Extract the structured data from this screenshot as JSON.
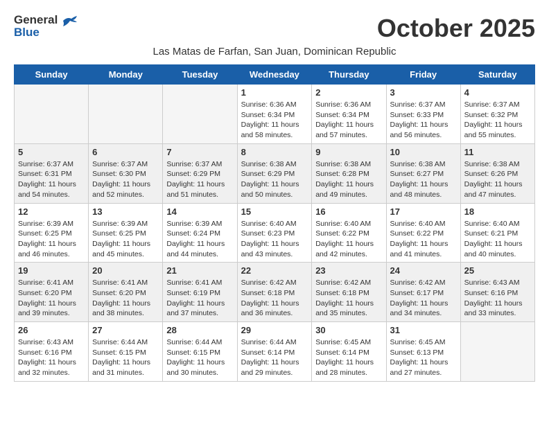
{
  "logo": {
    "general": "General",
    "blue": "Blue"
  },
  "title": "October 2025",
  "subtitle": "Las Matas de Farfan, San Juan, Dominican Republic",
  "days_of_week": [
    "Sunday",
    "Monday",
    "Tuesday",
    "Wednesday",
    "Thursday",
    "Friday",
    "Saturday"
  ],
  "weeks": [
    [
      {
        "day": "",
        "info": ""
      },
      {
        "day": "",
        "info": ""
      },
      {
        "day": "",
        "info": ""
      },
      {
        "day": "1",
        "info": "Sunrise: 6:36 AM\nSunset: 6:34 PM\nDaylight: 11 hours\nand 58 minutes."
      },
      {
        "day": "2",
        "info": "Sunrise: 6:36 AM\nSunset: 6:34 PM\nDaylight: 11 hours\nand 57 minutes."
      },
      {
        "day": "3",
        "info": "Sunrise: 6:37 AM\nSunset: 6:33 PM\nDaylight: 11 hours\nand 56 minutes."
      },
      {
        "day": "4",
        "info": "Sunrise: 6:37 AM\nSunset: 6:32 PM\nDaylight: 11 hours\nand 55 minutes."
      }
    ],
    [
      {
        "day": "5",
        "info": "Sunrise: 6:37 AM\nSunset: 6:31 PM\nDaylight: 11 hours\nand 54 minutes."
      },
      {
        "day": "6",
        "info": "Sunrise: 6:37 AM\nSunset: 6:30 PM\nDaylight: 11 hours\nand 52 minutes."
      },
      {
        "day": "7",
        "info": "Sunrise: 6:37 AM\nSunset: 6:29 PM\nDaylight: 11 hours\nand 51 minutes."
      },
      {
        "day": "8",
        "info": "Sunrise: 6:38 AM\nSunset: 6:29 PM\nDaylight: 11 hours\nand 50 minutes."
      },
      {
        "day": "9",
        "info": "Sunrise: 6:38 AM\nSunset: 6:28 PM\nDaylight: 11 hours\nand 49 minutes."
      },
      {
        "day": "10",
        "info": "Sunrise: 6:38 AM\nSunset: 6:27 PM\nDaylight: 11 hours\nand 48 minutes."
      },
      {
        "day": "11",
        "info": "Sunrise: 6:38 AM\nSunset: 6:26 PM\nDaylight: 11 hours\nand 47 minutes."
      }
    ],
    [
      {
        "day": "12",
        "info": "Sunrise: 6:39 AM\nSunset: 6:25 PM\nDaylight: 11 hours\nand 46 minutes."
      },
      {
        "day": "13",
        "info": "Sunrise: 6:39 AM\nSunset: 6:25 PM\nDaylight: 11 hours\nand 45 minutes."
      },
      {
        "day": "14",
        "info": "Sunrise: 6:39 AM\nSunset: 6:24 PM\nDaylight: 11 hours\nand 44 minutes."
      },
      {
        "day": "15",
        "info": "Sunrise: 6:40 AM\nSunset: 6:23 PM\nDaylight: 11 hours\nand 43 minutes."
      },
      {
        "day": "16",
        "info": "Sunrise: 6:40 AM\nSunset: 6:22 PM\nDaylight: 11 hours\nand 42 minutes."
      },
      {
        "day": "17",
        "info": "Sunrise: 6:40 AM\nSunset: 6:22 PM\nDaylight: 11 hours\nand 41 minutes."
      },
      {
        "day": "18",
        "info": "Sunrise: 6:40 AM\nSunset: 6:21 PM\nDaylight: 11 hours\nand 40 minutes."
      }
    ],
    [
      {
        "day": "19",
        "info": "Sunrise: 6:41 AM\nSunset: 6:20 PM\nDaylight: 11 hours\nand 39 minutes."
      },
      {
        "day": "20",
        "info": "Sunrise: 6:41 AM\nSunset: 6:20 PM\nDaylight: 11 hours\nand 38 minutes."
      },
      {
        "day": "21",
        "info": "Sunrise: 6:41 AM\nSunset: 6:19 PM\nDaylight: 11 hours\nand 37 minutes."
      },
      {
        "day": "22",
        "info": "Sunrise: 6:42 AM\nSunset: 6:18 PM\nDaylight: 11 hours\nand 36 minutes."
      },
      {
        "day": "23",
        "info": "Sunrise: 6:42 AM\nSunset: 6:18 PM\nDaylight: 11 hours\nand 35 minutes."
      },
      {
        "day": "24",
        "info": "Sunrise: 6:42 AM\nSunset: 6:17 PM\nDaylight: 11 hours\nand 34 minutes."
      },
      {
        "day": "25",
        "info": "Sunrise: 6:43 AM\nSunset: 6:16 PM\nDaylight: 11 hours\nand 33 minutes."
      }
    ],
    [
      {
        "day": "26",
        "info": "Sunrise: 6:43 AM\nSunset: 6:16 PM\nDaylight: 11 hours\nand 32 minutes."
      },
      {
        "day": "27",
        "info": "Sunrise: 6:44 AM\nSunset: 6:15 PM\nDaylight: 11 hours\nand 31 minutes."
      },
      {
        "day": "28",
        "info": "Sunrise: 6:44 AM\nSunset: 6:15 PM\nDaylight: 11 hours\nand 30 minutes."
      },
      {
        "day": "29",
        "info": "Sunrise: 6:44 AM\nSunset: 6:14 PM\nDaylight: 11 hours\nand 29 minutes."
      },
      {
        "day": "30",
        "info": "Sunrise: 6:45 AM\nSunset: 6:14 PM\nDaylight: 11 hours\nand 28 minutes."
      },
      {
        "day": "31",
        "info": "Sunrise: 6:45 AM\nSunset: 6:13 PM\nDaylight: 11 hours\nand 27 minutes."
      },
      {
        "day": "",
        "info": ""
      }
    ]
  ]
}
